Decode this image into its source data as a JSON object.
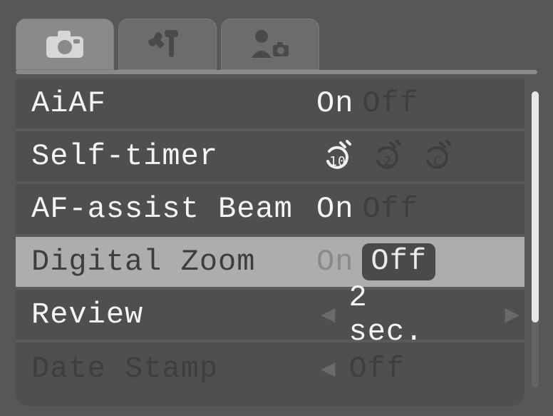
{
  "tabs": [
    {
      "id": "camera",
      "icon": "camera-icon",
      "active": true
    },
    {
      "id": "setup",
      "icon": "tools-icon",
      "active": false
    },
    {
      "id": "mycamera",
      "icon": "person-camera-icon",
      "active": false
    }
  ],
  "menu": {
    "items": [
      {
        "id": "aiaf",
        "label": "AiAF",
        "type": "options",
        "options": [
          "On",
          "Off"
        ],
        "selected_index": 0,
        "row_selected": false
      },
      {
        "id": "self_timer",
        "label": "Self-timer",
        "type": "timer-options",
        "options": [
          "10",
          "2",
          "C"
        ],
        "selected_index": 0,
        "row_selected": false
      },
      {
        "id": "af_assist",
        "label": "AF-assist Beam",
        "type": "options",
        "options": [
          "On",
          "Off"
        ],
        "selected_index": 0,
        "row_selected": false
      },
      {
        "id": "digital_zoom",
        "label": "Digital Zoom",
        "type": "options",
        "options": [
          "On",
          "Off"
        ],
        "selected_index": 1,
        "row_selected": true
      },
      {
        "id": "review",
        "label": "Review",
        "type": "spinner",
        "value": "2 sec.",
        "row_selected": false
      },
      {
        "id": "date_stamp",
        "label": "Date Stamp",
        "type": "spinner",
        "value": "Off",
        "row_selected": false,
        "dimmed": true
      }
    ]
  }
}
